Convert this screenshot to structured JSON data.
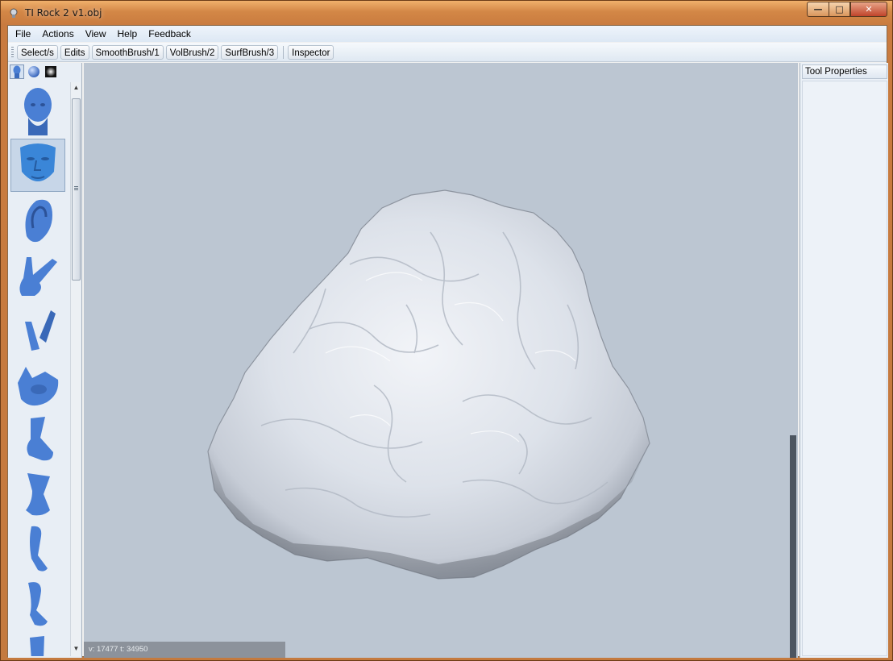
{
  "window": {
    "title": "TI Rock 2 v1.obj",
    "controls": {
      "minimize": "—",
      "maximize": "□",
      "close": "✕"
    }
  },
  "menubar": {
    "items": [
      "File",
      "Actions",
      "View",
      "Help",
      "Feedback"
    ]
  },
  "toolbar": {
    "buttons": [
      "Select/s",
      "Edits",
      "SmoothBrush/1",
      "VolBrush/2",
      "SurfBrush/3"
    ],
    "inspector": "Inspector"
  },
  "left_panel": {
    "tabs": [
      "head-tab-icon",
      "sphere-tab-icon",
      "material-tab-icon"
    ],
    "thumbnails": [
      "head",
      "face",
      "ear",
      "hand",
      "finger",
      "fist",
      "foot",
      "foot-side",
      "leg",
      "leg-side",
      "leg-partial"
    ],
    "selected_index": 1
  },
  "viewport": {
    "status": "v: 17477  t: 34950",
    "background": "#bcc6d2",
    "model_color": "#dfe5ee"
  },
  "right_panel": {
    "header": "Tool Properties"
  },
  "colors": {
    "title_bar": "#d38746",
    "tool_blue": "#4a7fd4"
  }
}
